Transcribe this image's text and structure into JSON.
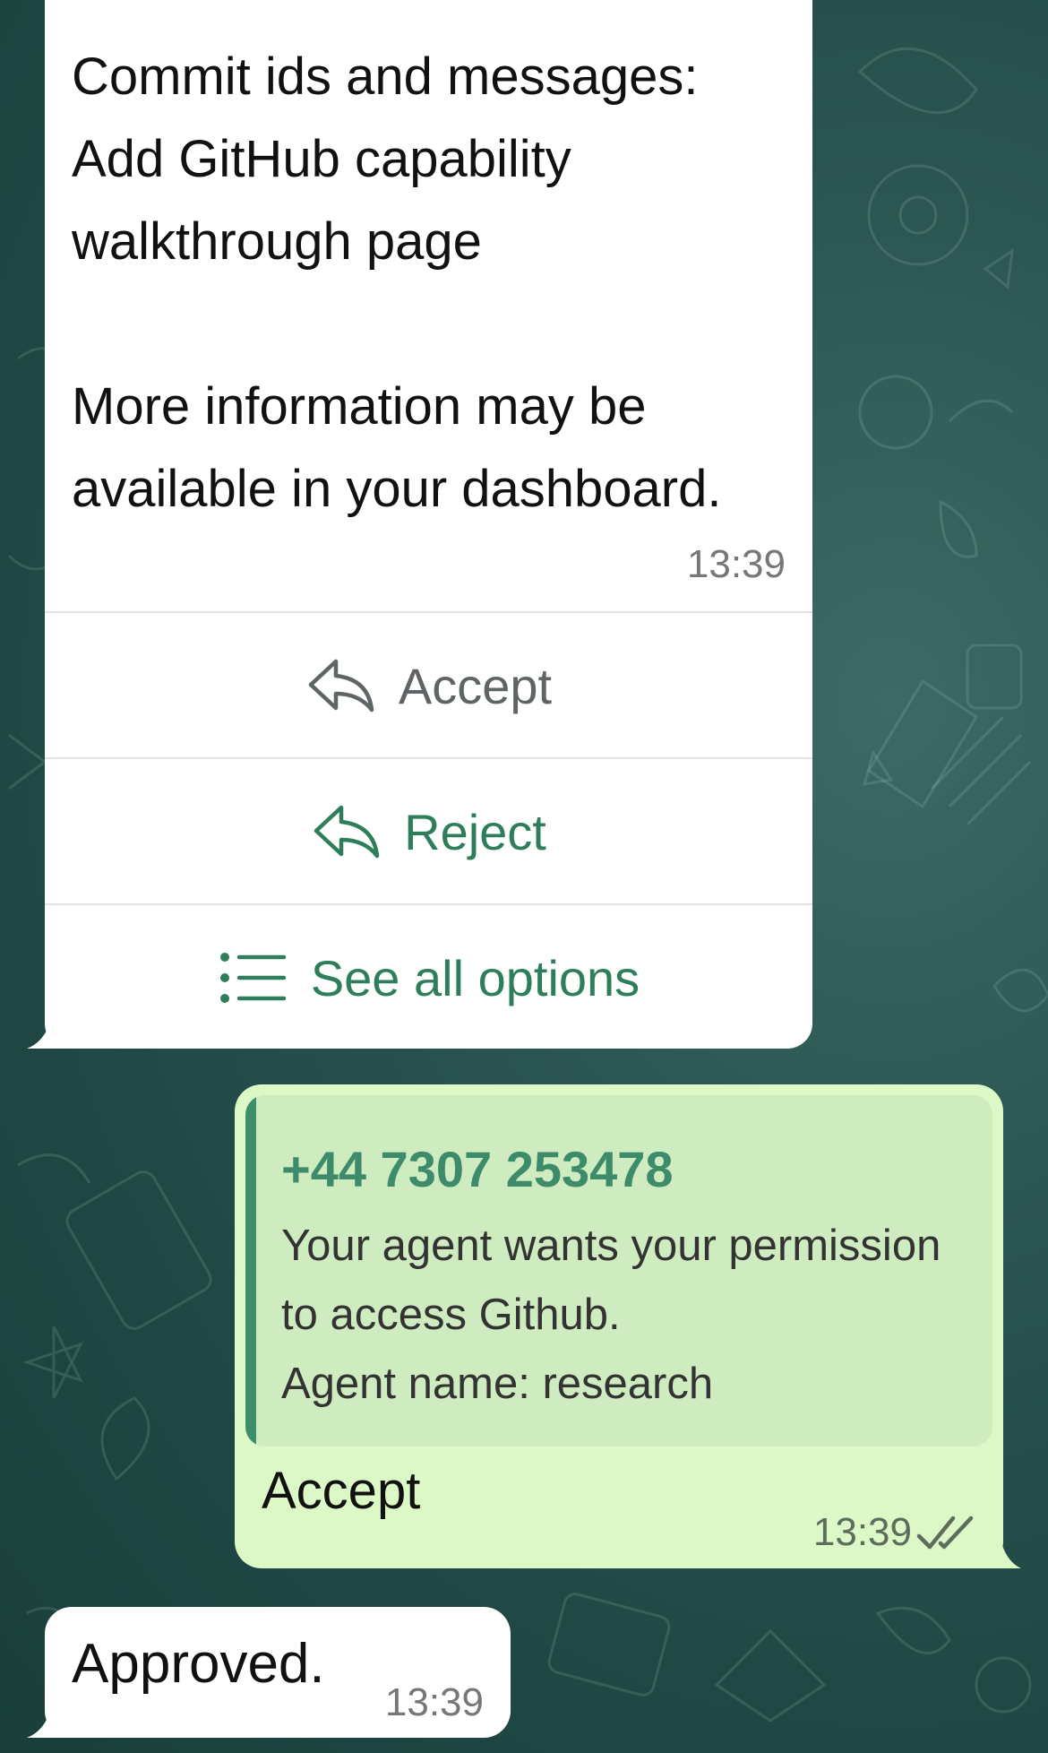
{
  "messages": {
    "interactive": {
      "text": "Commit ids and messages:\nAdd GitHub capability\nwalkthrough page\n\nMore information may be\navailable in your dashboard.",
      "time": "13:39",
      "buttons": {
        "accept": "Accept",
        "reject": "Reject",
        "options": "See all options"
      }
    },
    "sent": {
      "quote_sender": "+44 7307 253478",
      "quote_text": "Your agent wants your permission\nto access Github.\nAgent name: research",
      "text": "Accept",
      "time": "13:39",
      "status_icon": "double-check-icon"
    },
    "approved": {
      "text": "Approved.",
      "time": "13:39"
    }
  },
  "colors": {
    "background": "#1f4743",
    "incoming_bubble": "#ffffff",
    "outgoing_bubble": "#dcf8c6",
    "accent_green": "#2e7d5b",
    "quote_bar": "#3e8e6c"
  }
}
